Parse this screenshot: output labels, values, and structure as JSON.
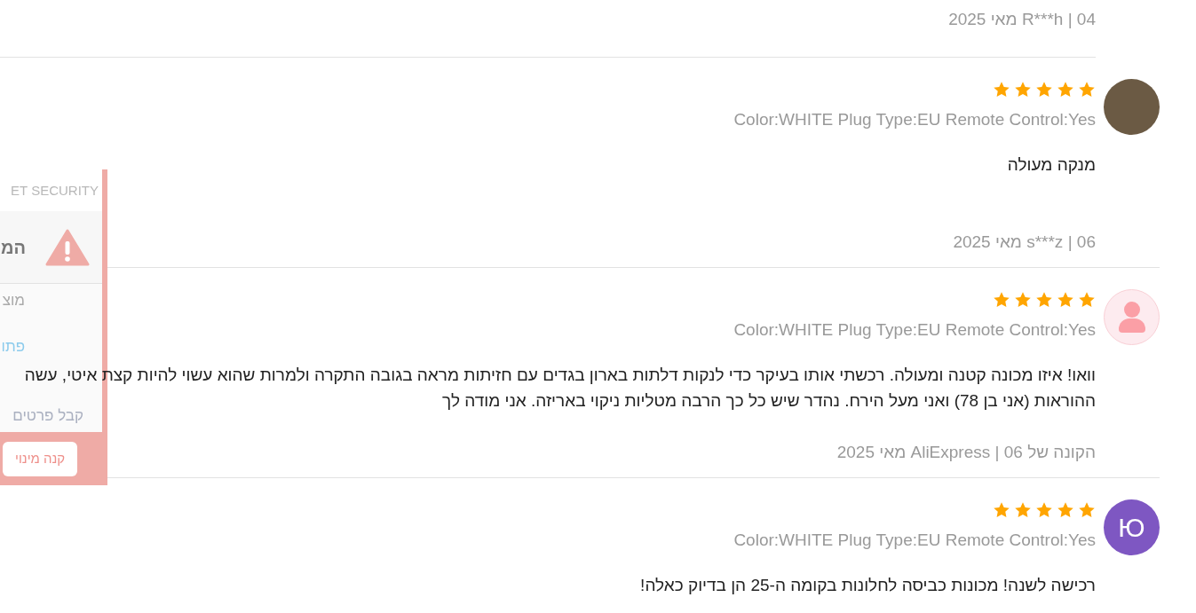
{
  "top_review": {
    "date": "R***h | 04 מאי 2025"
  },
  "reviews": [
    {
      "avatar": {
        "kind": "photo"
      },
      "stars": 5,
      "specs": "Color:WHITE Plug Type:EU Remote Control:Yes",
      "lines": [
        "מנקה מעולה"
      ],
      "date": "s***z | 06 מאי 2025"
    },
    {
      "avatar": {
        "kind": "default"
      },
      "stars": 5,
      "specs": "Color:WHITE Plug Type:EU Remote Control:Yes",
      "lines": [
        "וואו! איזו מכונה קטנה ומעולה. רכשתי אותו בעיקר כדי לנקות דלתות בארון בגדים עם חזיתות מראה בגובה התקרה ולמרות שהוא עשוי להיות קצת איטי, עשה",
        "ההוראות (אני בן 78) ואני מעל הירח. נהדר שיש כל כך הרבה מטליות ניקוי באריזה. אני מודה לך"
      ],
      "date": "הקונה של AliExpress | 06 מאי 2025"
    },
    {
      "avatar": {
        "kind": "letter",
        "letter": "Ю",
        "color": "#7e57c2"
      },
      "stars": 5,
      "specs": "Color:WHITE Plug Type:EU Remote Control:Yes",
      "lines": [
        "רכישה לשנה! מכונות כביסה לחלונות בקומה ה-25 הן בדיוק כאלה!"
      ]
    }
  ],
  "security_popup": {
    "header": "ET SECURITY",
    "title": "המ",
    "line_1": "מוצ",
    "link": "פתו",
    "line_2": "קבל פרטים",
    "button": "קנה מינוי"
  }
}
